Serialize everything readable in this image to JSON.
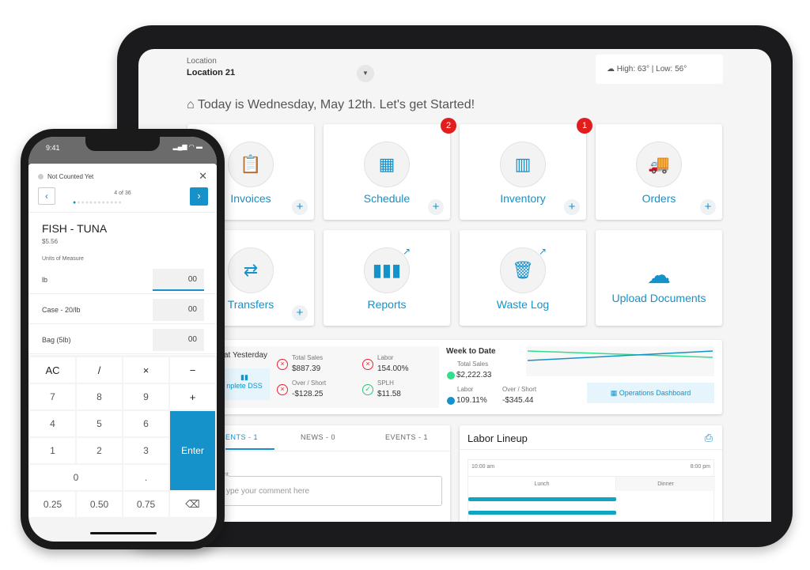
{
  "tablet": {
    "location_label": "Location",
    "location_value": "Location 21",
    "weather": "High: 63° | Low: 56°",
    "greeting": "Today is Wednesday, May 12th. Let's get Started!",
    "tiles": [
      {
        "label": "Invoices",
        "icon": "clipboard-icon",
        "plus": "+"
      },
      {
        "label": "Schedule",
        "icon": "calendar-icon",
        "plus": "+",
        "badge": "2"
      },
      {
        "label": "Inventory",
        "icon": "fridge-icon",
        "plus": "+",
        "badge": "1"
      },
      {
        "label": "Orders",
        "icon": "truck-icon",
        "plus": "+"
      },
      {
        "label": "Transfers",
        "icon": "swap-arrows-icon",
        "plus": "+"
      },
      {
        "label": "Reports",
        "icon": "bar-chart-icon"
      },
      {
        "label": "Waste Log",
        "icon": "trash-icon"
      },
      {
        "label": "Upload Documents",
        "icon": "cloud-upload-icon"
      }
    ],
    "yesterday": {
      "title": "at Yesterday",
      "dss": "nplete DSS",
      "total_sales_label": "Total Sales",
      "total_sales": "$887.39",
      "labor_label": "Labor",
      "labor": "154.00%",
      "over_short_label": "Over / Short",
      "over_short": "-$128.25",
      "splh_label": "SPLH",
      "splh": "$11.58"
    },
    "week": {
      "title": "Week to Date",
      "total_sales_label": "Total Sales",
      "total_sales": "$2,222.33",
      "labor_label": "Labor",
      "labor": "109.11%",
      "over_short_label": "Over / Short",
      "over_short": "-$345.44",
      "dashboard_button": "Operations Dashboard",
      "colors": {
        "sales": "#2ee08a",
        "labor": "#1592c9"
      }
    },
    "tabs": [
      "ENTS - 1",
      "NEWS - 0",
      "EVENTS - 1"
    ],
    "comment_label": "nt",
    "comment_placeholder": "ype your comment here",
    "labor_lineup": {
      "title": "Labor Lineup",
      "start": "10:00 am",
      "end": "8:00 pm",
      "shifts": [
        "Lunch",
        "Dinner"
      ]
    },
    "accent": "#1592c9"
  },
  "phone": {
    "time": "9:41",
    "status": "Not Counted Yet",
    "progress": "4 of 36",
    "item": "FISH - TUNA",
    "price": "$5.56",
    "uom_label": "Units of Measure",
    "units": [
      {
        "name": "lb",
        "value": "00"
      },
      {
        "name": "Case - 20/lb",
        "value": "00"
      },
      {
        "name": "Bag (5lb)",
        "value": "00"
      }
    ],
    "keys": [
      "AC",
      "/",
      "×",
      "−",
      "7",
      "8",
      "9",
      "+",
      "4",
      "5",
      "6",
      "1",
      "2",
      "3",
      "0",
      ".",
      "0.25",
      "0.50",
      "0.75"
    ],
    "enter": "Enter"
  }
}
